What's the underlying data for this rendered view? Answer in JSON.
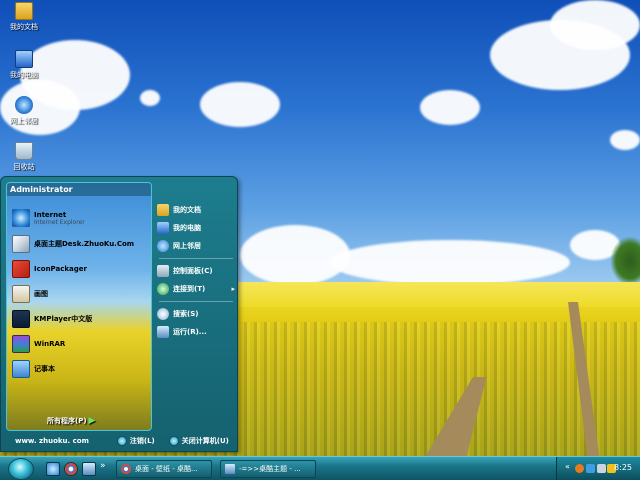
{
  "desktop": {
    "icons": [
      {
        "label": "我的文档",
        "icon": "folder-icon"
      },
      {
        "label": "我的电脑",
        "icon": "computer-icon"
      },
      {
        "label": "网上邻居",
        "icon": "network-icon"
      },
      {
        "label": "回收站",
        "icon": "recycle-bin-icon"
      }
    ]
  },
  "start_menu": {
    "user": "Administrator",
    "programs": [
      {
        "label": "Internet",
        "sub": "Internet Explorer",
        "icon": "internet-explorer-icon"
      },
      {
        "label": "桌面主题Desk.ZhuoKu.Com",
        "icon": "desk-theme-icon"
      },
      {
        "label": "IconPackager",
        "icon": "iconpackager-icon"
      },
      {
        "label": "画图",
        "icon": "paint-icon"
      },
      {
        "label": "KMPlayer中文版",
        "icon": "kmplayer-icon"
      },
      {
        "label": "WinRAR",
        "icon": "winrar-icon"
      },
      {
        "label": "记事本",
        "icon": "notepad-icon"
      }
    ],
    "all_programs": "所有程序(P)",
    "right": {
      "my_documents": "我的文档",
      "my_computer": "我的电脑",
      "network": "网上邻居",
      "control_panel": "控制面板(C)",
      "connect_to": "连接到(T)",
      "search": "搜索(S)",
      "run": "运行(R)..."
    },
    "footer": {
      "url": "www. zhuoku. com",
      "logoff": "注销(L)",
      "shutdown": "关闭计算机(U)"
    }
  },
  "taskbar": {
    "tasks": [
      {
        "label": "桌面 - 壁纸 - 桌酷...",
        "icon": "chrome-icon"
      },
      {
        "label": "-=>>桌酷主题 - ...",
        "icon": "desktop-icon"
      }
    ],
    "more": "»",
    "tray_more": "«",
    "clock": "8:25"
  },
  "colors": {
    "menu_bg": "#1d7d8e",
    "taskbar_bg": "#1a7488",
    "accent": "#4ec4d6"
  }
}
